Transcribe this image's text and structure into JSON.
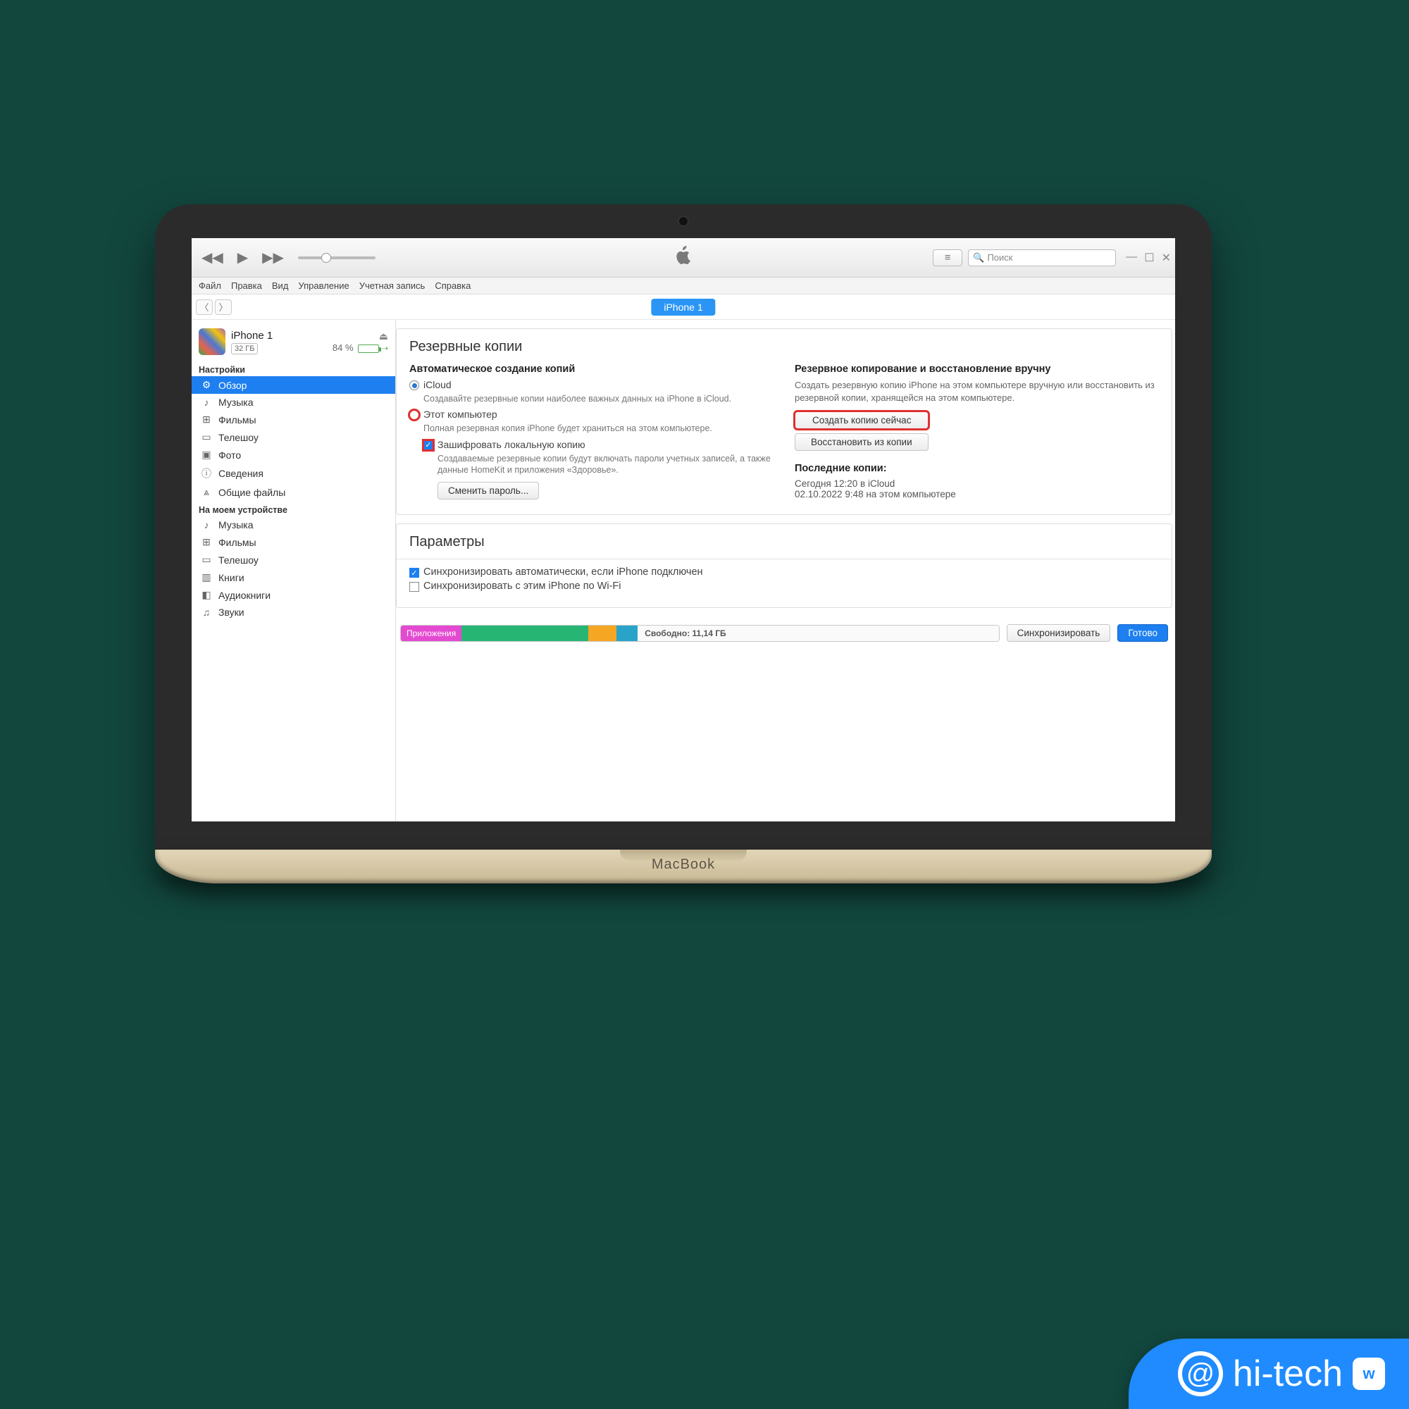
{
  "laptop_label": "MacBook",
  "menubar": [
    "Файл",
    "Правка",
    "Вид",
    "Управление",
    "Учетная запись",
    "Справка"
  ],
  "search_placeholder": "Поиск",
  "device_pill": "iPhone 1",
  "device": {
    "name": "iPhone 1",
    "capacity": "32 ГБ",
    "battery_pct": "84 %"
  },
  "sidebar": {
    "settings_header": "Настройки",
    "settings_items": [
      {
        "icon": "⚙",
        "label": "Обзор",
        "active": true
      },
      {
        "icon": "♪",
        "label": "Музыка"
      },
      {
        "icon": "⊞",
        "label": "Фильмы"
      },
      {
        "icon": "▭",
        "label": "Телешоу"
      },
      {
        "icon": "▣",
        "label": "Фото"
      },
      {
        "icon": "ⓘ",
        "label": "Сведения"
      },
      {
        "icon": "⩓",
        "label": "Общие файлы"
      }
    ],
    "device_header": "На моем устройстве",
    "device_items": [
      {
        "icon": "♪",
        "label": "Музыка"
      },
      {
        "icon": "⊞",
        "label": "Фильмы"
      },
      {
        "icon": "▭",
        "label": "Телешоу"
      },
      {
        "icon": "▥",
        "label": "Книги"
      },
      {
        "icon": "◧",
        "label": "Аудиокниги"
      },
      {
        "icon": "♫",
        "label": "Звуки"
      }
    ]
  },
  "backups": {
    "panel_title": "Резервные копии",
    "auto_title": "Автоматическое создание копий",
    "icloud_label": "iCloud",
    "icloud_desc": "Создавайте резервные копии наиболее важных данных на iPhone в iCloud.",
    "this_pc_label": "Этот компьютер",
    "this_pc_desc": "Полная резервная копия iPhone будет храниться на этом компьютере.",
    "encrypt_label": "Зашифровать локальную копию",
    "encrypt_desc": "Создаваемые резервные копии будут включать пароли учетных записей, а также данные HomeKit и приложения «Здоровье».",
    "change_pw_btn": "Сменить пароль...",
    "manual_title": "Резервное копирование и восстановление вручну",
    "manual_desc": "Создать резервную копию iPhone на этом компьютере вручную или восстановить из резервной копии, хранящейся на этом компьютере.",
    "backup_now_btn": "Создать копию сейчас",
    "restore_btn": "Восстановить из копии",
    "last_title": "Последние копии:",
    "last_line1": "Сегодня 12:20 в iCloud",
    "last_line2": "02.10.2022 9:48 на этом компьютере"
  },
  "params": {
    "panel_title": "Параметры",
    "auto_sync": "Синхронизировать автоматически, если iPhone подключен",
    "wifi_sync": "Синхронизировать с этим iPhone по Wi-Fi"
  },
  "footer": {
    "apps_label": "Приложения",
    "free_label": "Свободно: 11,14 ГБ",
    "sync_btn": "Синхронизировать",
    "done_btn": "Готово"
  },
  "watermark": "hi-tech"
}
